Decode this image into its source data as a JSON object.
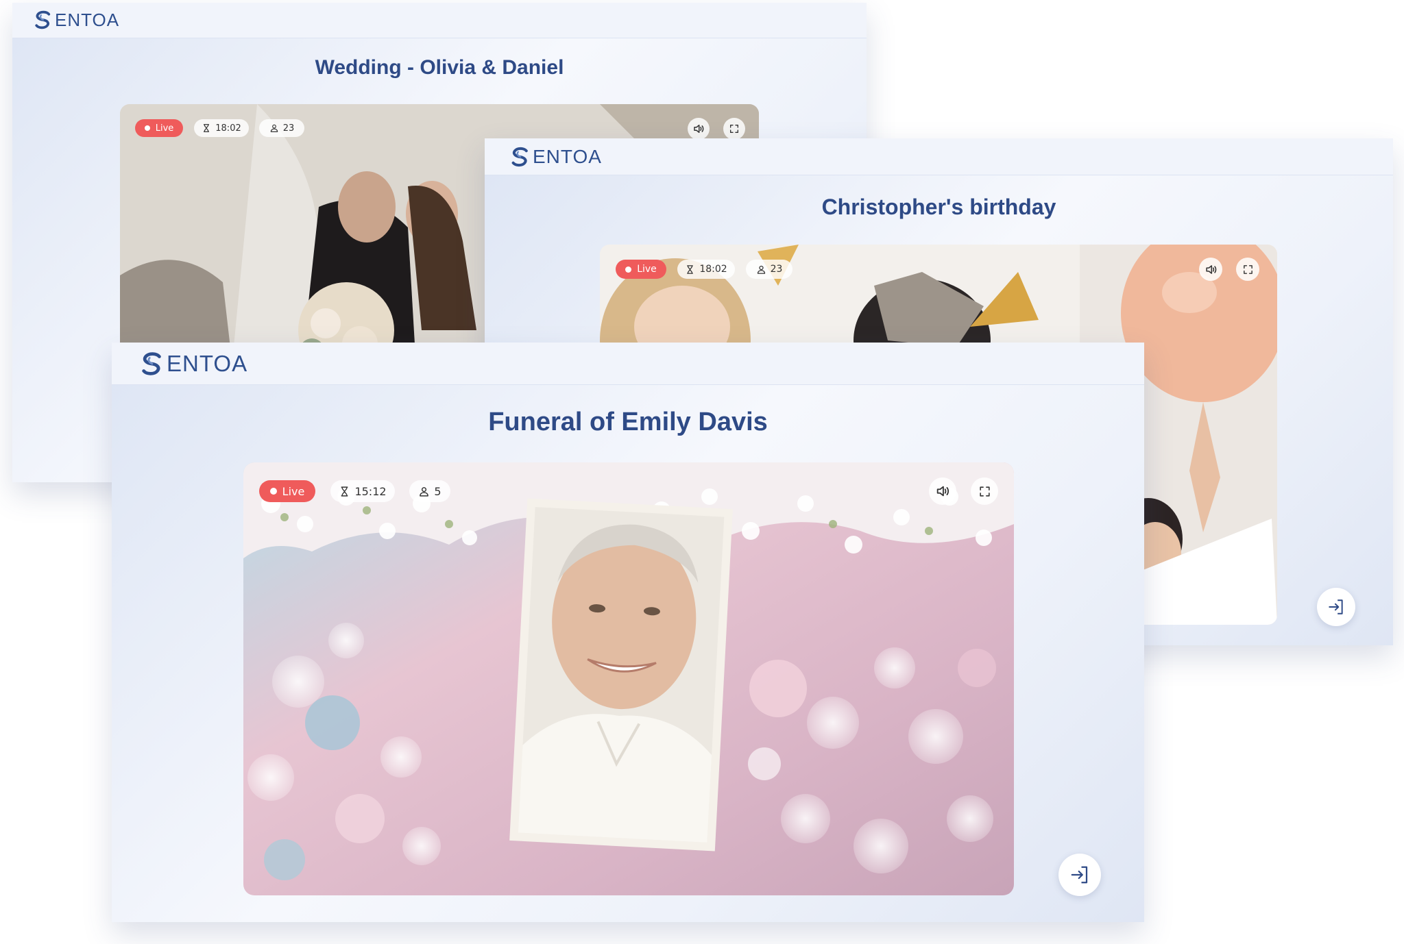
{
  "brand": {
    "name": "SENTOA",
    "logo_letter": "S",
    "logo_rest": "ENTOA",
    "color": "#2e4f8e"
  },
  "streams": [
    {
      "title": "Wedding - Olivia & Daniel",
      "status": "Live",
      "duration": "18:02",
      "viewers": "23"
    },
    {
      "title": "Christopher's birthday",
      "status": "Live",
      "duration": "18:02",
      "viewers": "23"
    },
    {
      "title": "Funeral of Emily Davis",
      "status": "Live",
      "duration": "15:12",
      "viewers": "5"
    }
  ],
  "icons": {
    "duration": "hourglass-icon",
    "viewers": "user-icon",
    "volume": "volume-icon",
    "fullscreen": "fullscreen-icon",
    "exit": "exit-icon"
  },
  "colors": {
    "live": "#ef5b5b",
    "title": "#2e4a86"
  }
}
